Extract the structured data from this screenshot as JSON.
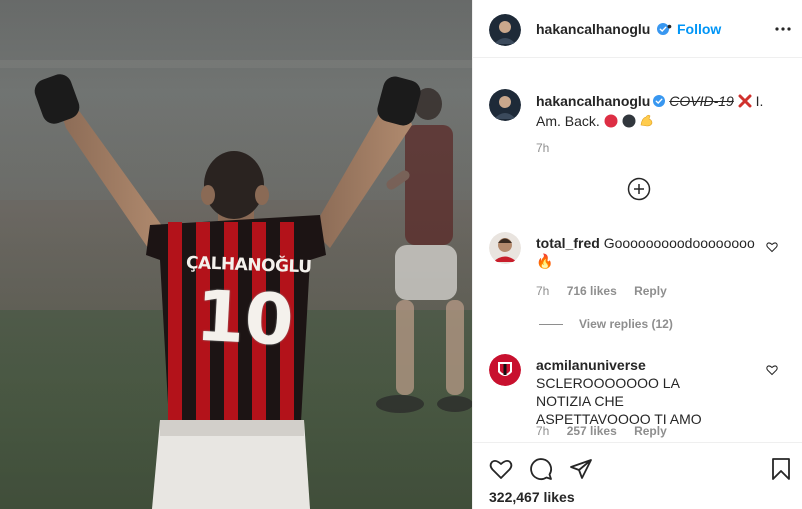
{
  "post": {
    "username": "hakancalhanoglu",
    "follow_label": "Follow",
    "dot": "•",
    "more_icon": "more-horizontal-icon",
    "verified_icon": "verified-badge-icon",
    "jersey_name": "ÇALHANOĞLU",
    "jersey_number": "10",
    "colors": {
      "accent": "#0095f6",
      "muted": "#8e8e8e",
      "text": "#262626",
      "border": "#efefef"
    }
  },
  "caption": {
    "username": "hakancalhanoglu",
    "strike_text": "COVID-19",
    "text": "I. Am. Back.",
    "time": "7h"
  },
  "load_more_icon": "plus-circle-icon",
  "comments": [
    {
      "username": "total_fred",
      "text": "Gooooooooodoooooooo",
      "emoji": "🔥",
      "time": "7h",
      "likes": "716 likes",
      "reply": "Reply",
      "view_replies": "View replies (12)"
    },
    {
      "username": "acmilanuniverse",
      "text": "SCLEROOOOOOO LA NOTIZIA CHE ASPETTAVOOOO TI AMO",
      "time": "7h",
      "likes": "257 likes",
      "reply": "Reply"
    }
  ],
  "actions": {
    "like_icon": "heart-icon",
    "comment_icon": "comment-icon",
    "share_icon": "share-icon",
    "save_icon": "bookmark-icon",
    "likes": "322,467 likes"
  }
}
